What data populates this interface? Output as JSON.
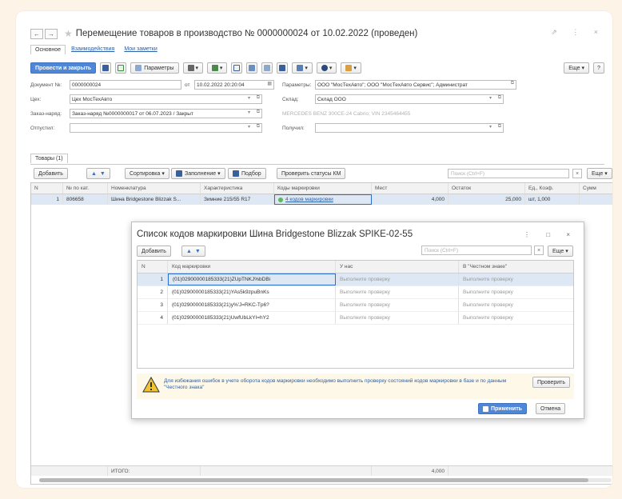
{
  "window": {
    "title": "Перемещение товаров в производство № 0000000024  от 10.02.2022 (проведен)",
    "back": "←",
    "forward": "→",
    "icons": "⇗ ⋮ ×"
  },
  "top_tabs": [
    "Основное",
    "Взаимодействия",
    "Мои заметки"
  ],
  "toolbar": {
    "post_close": "Провести и закрыть",
    "params": "Параметры",
    "more": "Еще",
    "help": "?"
  },
  "form": {
    "doc_label": "Документ №:",
    "doc_value": "0000000024",
    "date_label": "от",
    "date_value": "10.02.2022 20:20:04",
    "params_label": "Параметры:",
    "params_value": "ООО \"МосТехАвто\"; ООО \"МосТехАвто Сервис\"; Администрат",
    "shop_label": "Цех:",
    "shop_value": "Цех МосТехАвто",
    "warehouse_label": "Склад:",
    "warehouse_value": "Склад ООО",
    "order_label": "Заказ-наряд:",
    "order_value": "Заказ-наряд №0000000017  от 06.07.2023 / Закрыт",
    "car_info": "MERCEDES BENZ 300CE-24 Cabrio; VIN 2345464455",
    "released_label": "Отпустил:",
    "released_value": "",
    "received_label": "Получил:",
    "received_value": ""
  },
  "goods_tab": "Товары (1)",
  "grid_toolbar": {
    "add": "Добавить",
    "sort": "Сортировка",
    "fill": "Заполнение",
    "pick": "Подбор",
    "check_km": "Проверить статусы КМ",
    "search_placeholder": "Поиск (Ctrl+F)",
    "more": "Еще"
  },
  "grid": {
    "columns": [
      "N",
      "№ по кат.",
      "Номенклатура",
      "Характеристика",
      "Коды маркировки",
      "Мест",
      "Остаток",
      "Ед., Коэф.",
      "Сумм"
    ],
    "rows": [
      {
        "n": "1",
        "cat": "806658",
        "name": "Шина Bridgestone Blizzak S...",
        "char": "Зимние 215/55 R17",
        "codes": "4 кодов маркировки",
        "places": "4,000",
        "rest": "25,000",
        "unit": "шт, 1,000",
        "sum": ""
      }
    ],
    "footer": {
      "label": "ИТОГО:",
      "places": "4,000"
    }
  },
  "dialog": {
    "title": "Список кодов маркировки Шина Bridgestone Blizzak SPIKE-02-55",
    "icons": "⋮ □ ×",
    "add": "Добавить",
    "search_placeholder": "Поиск (Ctrl+F)",
    "more": "Еще",
    "columns": [
      "N",
      "Код маркировки",
      "У нас",
      "В \"Честном знаке\""
    ],
    "rows": [
      {
        "n": "1",
        "code": "(01)02900000185333(21)ZUpTNKJ%bDBi",
        "ours": "Выполните проверку",
        "cz": "Выполните проверку"
      },
      {
        "n": "2",
        "code": "(01)02900000185333(21)YAs5k9zpuBnKs",
        "ours": "Выполните проверку",
        "cz": "Выполните проверку"
      },
      {
        "n": "3",
        "code": "(01)02900000185333(21)y%'J=RKC-Tp6?",
        "ours": "Выполните проверку",
        "cz": "Выполните проверку"
      },
      {
        "n": "4",
        "code": "(01)02900000185333(21)UwfUbLkYI=hY2",
        "ours": "Выполните проверку",
        "cz": "Выполните проверку"
      }
    ],
    "warning": "Для избежания ошибок в учете оборота кодов маркировки  необходимо выполнить проверку состояний кодов маркировки в базе и по данным \"Честного знака\"",
    "check": "Проверить",
    "apply": "Применить",
    "cancel": "Отмена"
  },
  "colors": {
    "primary": "#4e87d8",
    "link": "#2b5fa8",
    "selected_row": "#dde8f4",
    "warning_bg": "#fef8e8",
    "warning_icon": "#f1c232"
  }
}
